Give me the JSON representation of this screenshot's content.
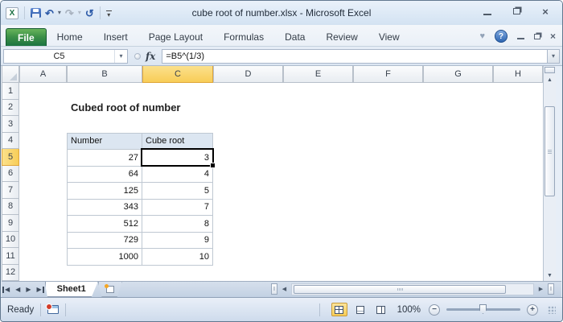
{
  "window": {
    "title": "cube root of number.xlsx - Microsoft Excel"
  },
  "ribbon": {
    "file_tab": "File",
    "tabs": [
      "Home",
      "Insert",
      "Page Layout",
      "Formulas",
      "Data",
      "Review",
      "View"
    ]
  },
  "formula_bar": {
    "cell_reference": "C5",
    "fx_label": "fx",
    "formula": "=B5^(1/3)"
  },
  "grid": {
    "column_headers": [
      "A",
      "B",
      "C",
      "D",
      "E",
      "F",
      "G",
      "H"
    ],
    "selected_column": "C",
    "row_headers": [
      "1",
      "2",
      "3",
      "4",
      "5",
      "6",
      "7",
      "8",
      "9",
      "10",
      "11",
      "12"
    ],
    "selected_row": "5",
    "selected_cell": "C5",
    "worksheet_title": "Cubed root of number",
    "table": {
      "headers": [
        "Number",
        "Cube root"
      ],
      "rows": [
        [
          "27",
          "3"
        ],
        [
          "64",
          "4"
        ],
        [
          "125",
          "5"
        ],
        [
          "343",
          "7"
        ],
        [
          "512",
          "8"
        ],
        [
          "729",
          "9"
        ],
        [
          "1000",
          "10"
        ]
      ]
    }
  },
  "sheet_tabs": {
    "active": "Sheet1"
  },
  "status_bar": {
    "mode": "Ready",
    "zoom_level": "100%"
  },
  "icons": {
    "undo": "↶",
    "redo": "↷",
    "repeat": "↺",
    "dropdown": "▾",
    "expand_ribbon": "♥",
    "help": "?",
    "scroll_up": "▲",
    "scroll_down": "▼",
    "scroll_left": "◀",
    "scroll_right": "▶",
    "nav_prev": "◀",
    "nav_next": "▶",
    "zoom_out": "−",
    "zoom_in": "+",
    "close": "×",
    "split_handle": "I"
  },
  "colors": {
    "file-tab-green": "#2D7D46",
    "selection-amber": "#F8CD57",
    "table-header-fill": "#DCE6F1",
    "help-blue": "#2E66B2",
    "selection-border": "#000000"
  }
}
